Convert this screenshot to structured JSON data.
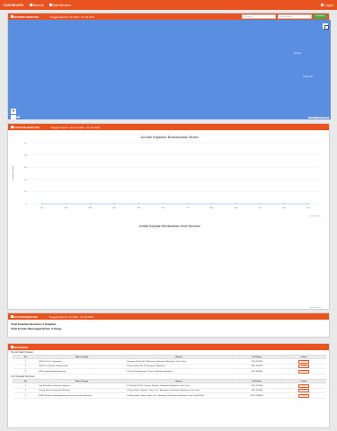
{
  "topbar": {
    "brand": "DASHBOARD",
    "nav": [
      "Beranda",
      "Data Bencana"
    ],
    "logout": "Logout"
  },
  "map_panel": {
    "title": "MAPPING BENCANA",
    "range": "Tanggal Data 01 Juli 2023 - 31 Juli 2023",
    "search1_placeholder": "Ke Tanggal",
    "search2_placeholder": "Sampai Tanggal",
    "filter_button": "Tampilkan",
    "labels": [
      "Sibolga",
      "Pulau Nias"
    ],
    "zoom_in": "+",
    "zoom_out": "−",
    "attribution": "Leaflet | © OpenStreetMap"
  },
  "chart_panel": {
    "title": "STATISTIK BENCANA",
    "range": "Tanggal Data 01 Januari 2023 - 31 Juli 2023",
    "chart_data": [
      {
        "type": "line",
        "title": "Jumlah Kejadian Berdasarkan Bulan",
        "ylabel": "Jumlah Kejadian",
        "categories": [
          "Jan",
          "Feb",
          "Mar",
          "Apr",
          "Mei",
          "Jun",
          "Jul",
          "Agu",
          "Sep",
          "Okt",
          "Nov",
          "Des"
        ],
        "yticks": [
          "1.0",
          "0.8",
          "0.6",
          "0.4",
          "0.2",
          "0"
        ],
        "ylim": [
          0,
          1
        ],
        "series": [
          {
            "values": [
              0,
              0,
              0,
              0,
              0,
              0,
              0,
              0,
              0,
              0,
              0,
              0
            ]
          }
        ],
        "credit": "Highcharts.com"
      },
      {
        "type": "bar",
        "title": "Jumlah Kejadian Berdasarkan Jenis Bencana",
        "categories": [],
        "series": [],
        "credit": "Highcharts.com"
      }
    ]
  },
  "summary_panel": {
    "title": "CUSTOM BENCANA",
    "range": "Tanggal Data 01 Juli 2023 - 31 Juli 2023",
    "lines": [
      "Total Kejadian Bencana: 0 Kejadian",
      "Total Korban Meninggal Dunia: 0 Orang"
    ]
  },
  "table_panel": {
    "title": "INFORMASI",
    "sections": [
      {
        "label": "Rumah Sakit Rujukan",
        "headers": [
          "No",
          "Nama Tempat",
          "Alamat",
          "No Telpon",
          "Lokasi"
        ],
        "rows": [
          {
            "no": "1",
            "name": "RSUD Prof Dr. Soekandar",
            "addr": "Jl. Hayam Wuruk No.25 Mojosari, Kabupaten Mojokerto, Jawa Timur",
            "tel": "0321-593351",
            "lok": "Lokasi"
          },
          {
            "no": "2",
            "name": "RSUD Dr. Wahidin Sudirohusodo",
            "addr": "Jl. Raya Jabon No. 57 Kabupaten Mojokerto",
            "tel": "0321-382078",
            "lok": "Lokasi"
          },
          {
            "no": "3",
            "name": "RSU Sumberglagah Mojokerto",
            "addr": "Jl. Raya Sumberglagah, Pacet, Kabupaten Mojokerto",
            "tel": "0321-690431",
            "lok": "Lokasi"
          }
        ]
      },
      {
        "label": "Unit Tanggap Bencana",
        "headers": [
          "No",
          "Nama Tempat",
          "Alamat",
          "No Telpon",
          "Lokasi"
        ],
        "rows": [
          {
            "no": "1",
            "name": "Unit Pemadam Kebakaran Mojosari",
            "addr": "Jl. Pemuda No.26, Kauman, Mojosari, Kabupaten Mojokerto, Jawa Timur",
            "tel": "0321-592284",
            "lok": "Lokasi"
          },
          {
            "no": "2",
            "name": "Palang Merah Kabupaten Mojokerto",
            "addr": "Jl. Raya Jabon, Kebalen, Jabon, Kec. Mojoanyar, Kabupaten Mojokerto, Jawa Timur",
            "tel": "0321-399408",
            "lok": "Lokasi"
          },
          {
            "no": "3",
            "name": "BPBD (Badan Penanggulangan Bencana Daerah) Mojokerto",
            "addr": "Jl. Raya Jabon, Jabon, Jabon, Kec. Mojoanyar, Kabupaten Mojokerto, Jawa Timur 61364",
            "tel": "0321-5280807",
            "lok": "Lokasi"
          }
        ]
      }
    ]
  }
}
